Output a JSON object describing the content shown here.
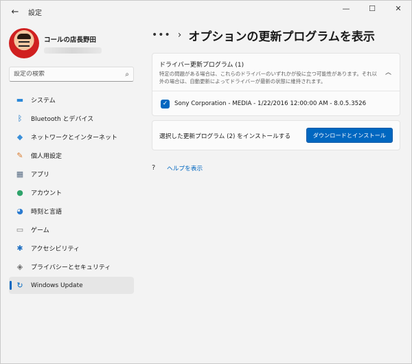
{
  "window": {
    "title": "設定",
    "back_glyph": "←",
    "minimize_glyph": "—",
    "maximize_glyph": "☐",
    "close_glyph": "✕"
  },
  "profile": {
    "name": "コールの店長野田"
  },
  "search": {
    "placeholder": "設定の検索",
    "icon": "search-icon",
    "icon_glyph": "⌕"
  },
  "nav": {
    "items": [
      {
        "label": "システム",
        "icon": "monitor-icon",
        "glyph": "▬",
        "color": "#2b88d8"
      },
      {
        "label": "Bluetooth とデバイス",
        "icon": "bluetooth-icon",
        "glyph": "ᛒ",
        "color": "#0067c0"
      },
      {
        "label": "ネットワークとインターネット",
        "icon": "wifi-icon",
        "glyph": "◆",
        "color": "#3a8fd9"
      },
      {
        "label": "個人用設定",
        "icon": "brush-icon",
        "glyph": "✎",
        "color": "#d9792b"
      },
      {
        "label": "アプリ",
        "icon": "apps-icon",
        "glyph": "▦",
        "color": "#5a6e85"
      },
      {
        "label": "アカウント",
        "icon": "account-icon",
        "glyph": "●",
        "color": "#2fa36b"
      },
      {
        "label": "時刻と言語",
        "icon": "globe-clock-icon",
        "glyph": "◕",
        "color": "#2b7bd0"
      },
      {
        "label": "ゲーム",
        "icon": "gamepad-icon",
        "glyph": "▭",
        "color": "#7a7a7a"
      },
      {
        "label": "アクセシビリティ",
        "icon": "accessibility-icon",
        "glyph": "✱",
        "color": "#1f6fc2"
      },
      {
        "label": "プライバシーとセキュリティ",
        "icon": "shield-icon",
        "glyph": "◈",
        "color": "#6b6b6b"
      },
      {
        "label": "Windows Update",
        "icon": "update-icon",
        "glyph": "↻",
        "color": "#0067c0",
        "active": true
      }
    ],
    "accent": "#0067c0"
  },
  "main": {
    "more_glyph": "•••",
    "chevron_glyph": "›",
    "title": "オプションの更新プログラムを表示",
    "drivers": {
      "title": "ドライバー更新プログラム (1)",
      "description": "特定の問題がある場合は、これらのドライバーのいずれかが役に立つ可能性があります。それ以外の場合は、自動更新によってドライバーが最新の状態に維持されます。",
      "collapse_glyph": "︿",
      "update_item": "Sony Corporation - MEDIA - 1/22/2016 12:00:00 AM - 8.0.5.3526",
      "checked": true,
      "check_glyph": "✓"
    },
    "install": {
      "text": "選択した更新プログラム (2) をインストールする",
      "button_label": "ダウンロードとインストール"
    },
    "help": {
      "glyph": "?",
      "label": "ヘルプを表示"
    }
  }
}
